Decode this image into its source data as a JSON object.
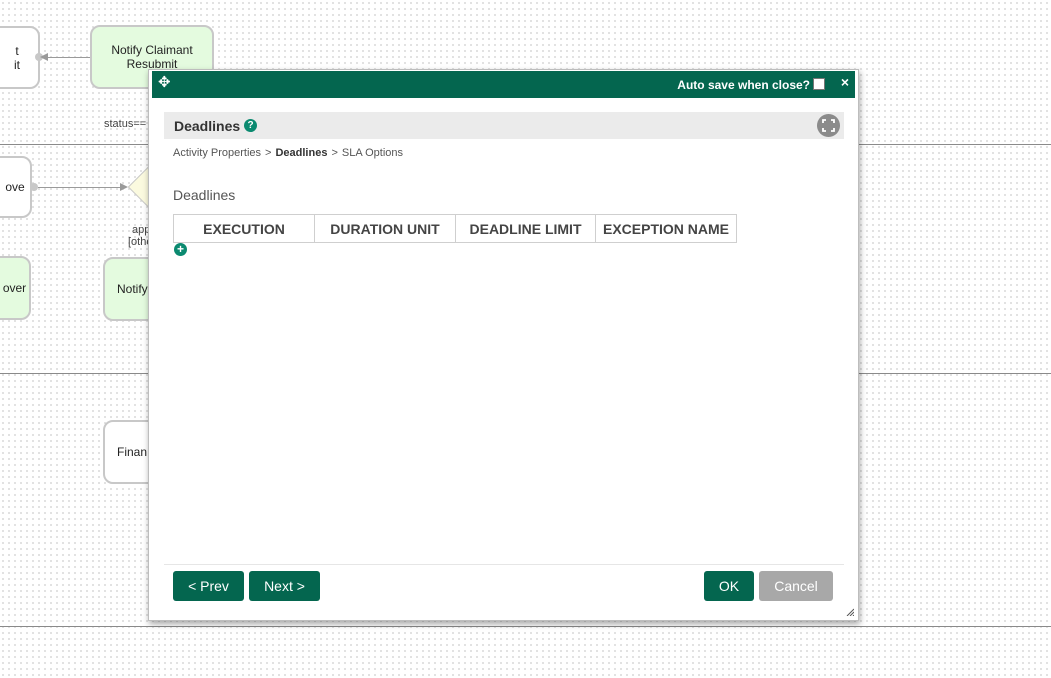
{
  "canvas": {
    "nodes": {
      "submit_partial": "t\nit",
      "notify_claimant_resubmit": "Notify Claimant\nResubmit",
      "approve_partial": "ove",
      "notify_partial": "Notify",
      "approver_partial": "over",
      "finance_partial": "Finan"
    },
    "labels": {
      "status_condition": "status==",
      "app_condition": "app",
      "other_condition": "[othe"
    }
  },
  "modal": {
    "autosave_label": "Auto save when close?",
    "autosave_checked": false,
    "close_symbol": "×",
    "move_symbol": "✥",
    "section_title": "Deadlines",
    "help_symbol": "?",
    "breadcrumb": {
      "items": [
        "Activity Properties",
        "Deadlines",
        "SLA Options"
      ],
      "current_index": 1,
      "separator": ">"
    },
    "subheading": "Deadlines",
    "table": {
      "columns": [
        "EXECUTION",
        "DURATION UNIT",
        "DEADLINE LIMIT",
        "EXCEPTION NAME"
      ],
      "rows": []
    },
    "add_symbol": "+",
    "buttons": {
      "prev": "< Prev",
      "next": "Next >",
      "ok": "OK",
      "cancel": "Cancel"
    }
  },
  "colors": {
    "primary": "#04664f",
    "disabled": "#a8a8a8",
    "help_icon": "#0b8a70",
    "node_green": "#e4fbdf",
    "header_bg": "#ebebeb"
  }
}
